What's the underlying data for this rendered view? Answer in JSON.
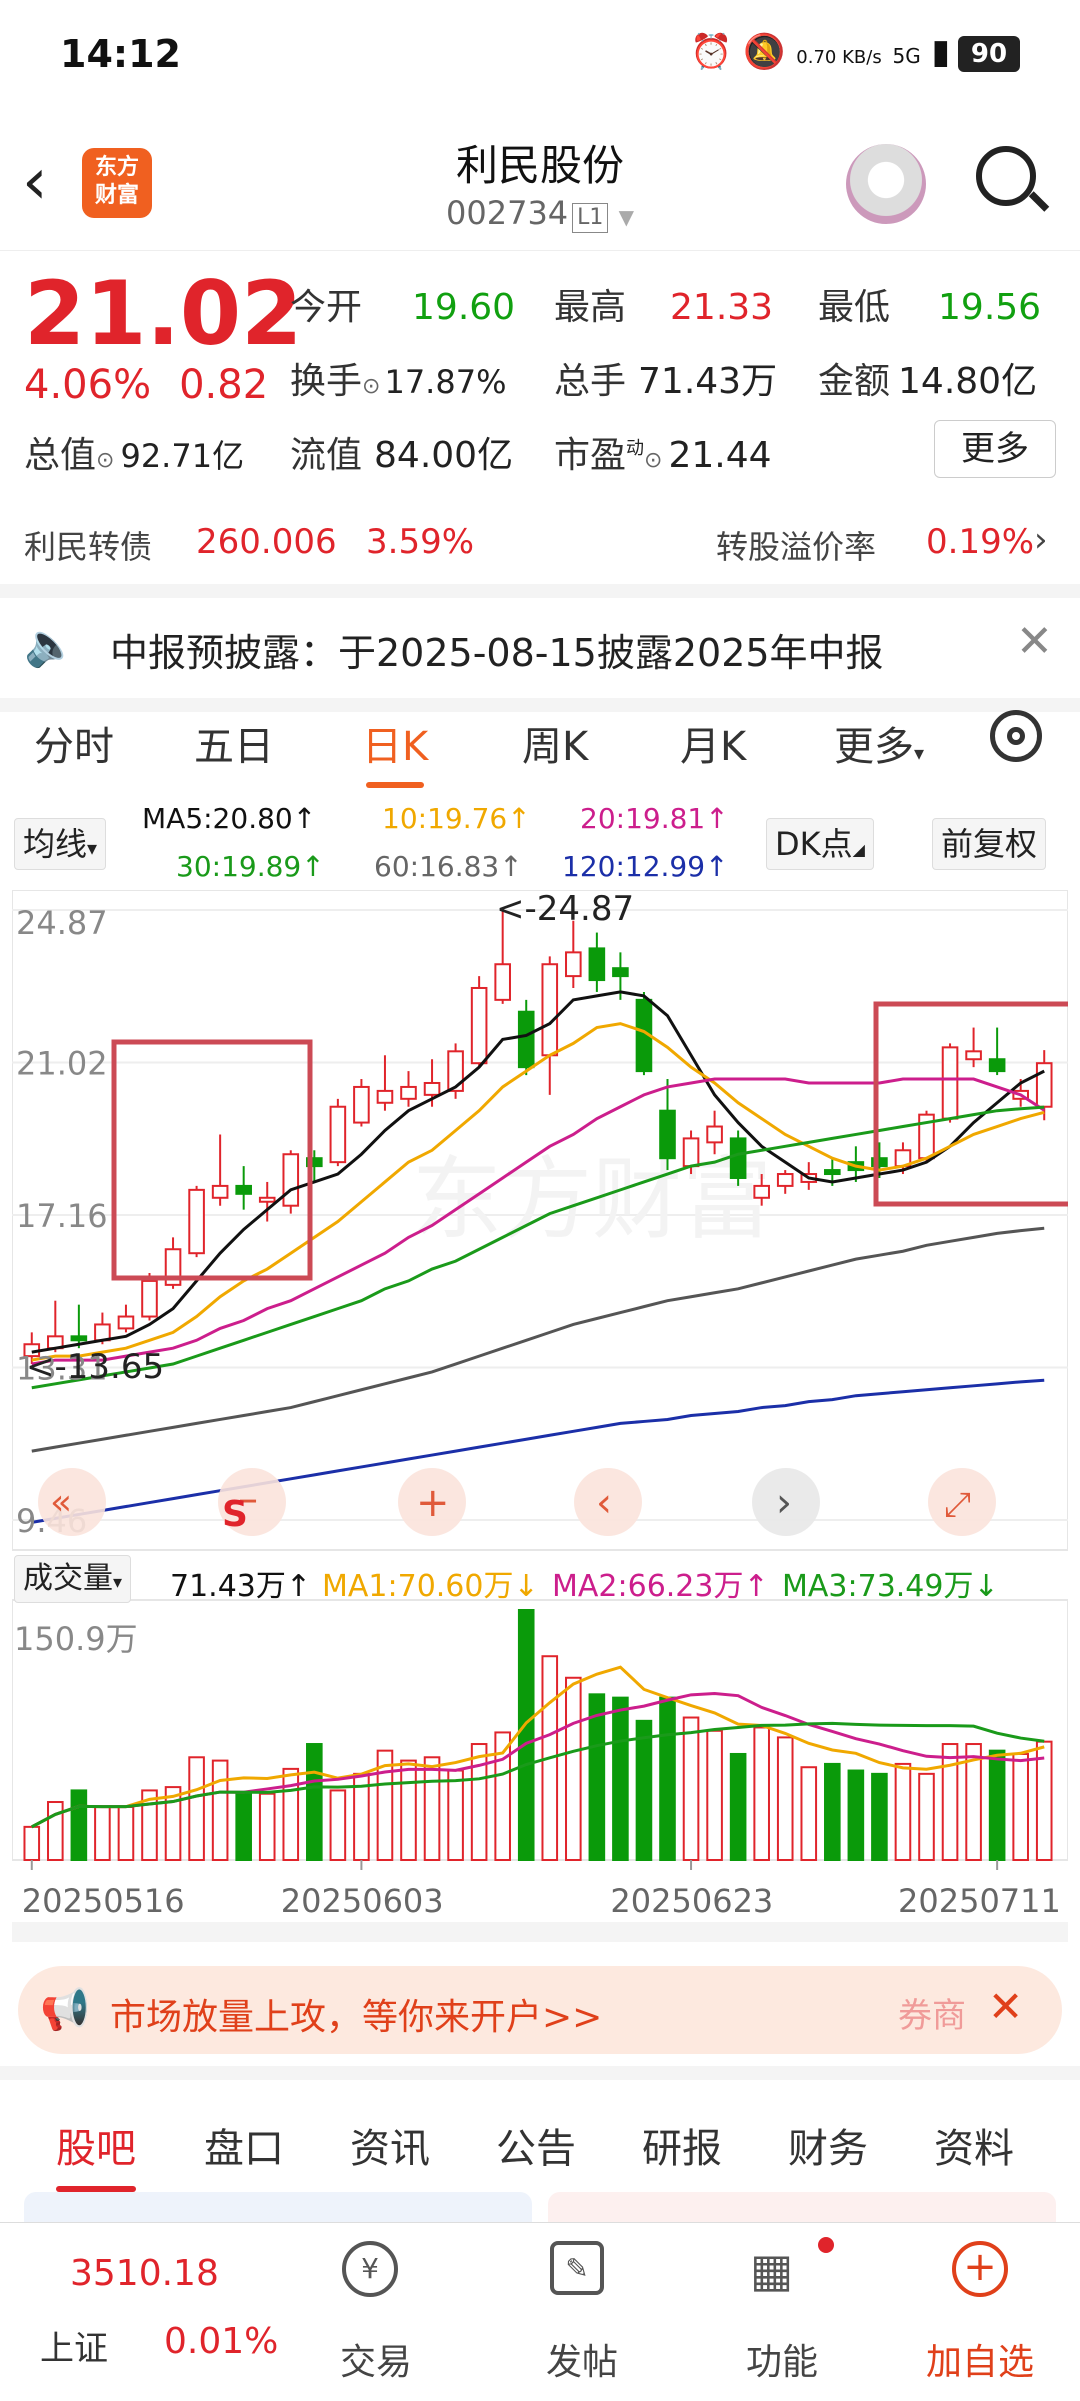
{
  "status": {
    "time": "14:12",
    "net_speed": "0.70 KB/s",
    "network": "5G",
    "battery": "90"
  },
  "header": {
    "title": "利民股份",
    "code": "002734",
    "board": "L1",
    "logo_line1": "东方",
    "logo_line2": "财富"
  },
  "quote": {
    "price": "21.02",
    "change_pct": "4.06%",
    "change": "0.82",
    "open_label": "今开",
    "open": "19.60",
    "high_label": "最高",
    "high": "21.33",
    "low_label": "最低",
    "low": "19.56",
    "turnover_label": "换手",
    "turnover": "17.87%",
    "volume_label": "总手",
    "volume": "71.43万",
    "amount_label": "金额",
    "amount": "14.80亿",
    "mktcap_label": "总值",
    "mktcap": "92.71亿",
    "float_label": "流值",
    "float": "84.00亿",
    "pe_label": "市盈",
    "pe_sup": "动",
    "pe": "21.44",
    "more": "更多"
  },
  "cbond": {
    "name": "利民转债",
    "price": "260.006",
    "pct": "3.59%",
    "premium_label": "转股溢价率",
    "premium": "0.19%"
  },
  "notice": {
    "text": "中报预披露：于2025-08-15披露2025年中报"
  },
  "ktabs": [
    "分时",
    "五日",
    "日K",
    "周K",
    "月K",
    "更多"
  ],
  "ma": {
    "selector": "均线",
    "ma5": "MA5:20.80",
    "ma10": "10:19.76",
    "ma20": "20:19.81",
    "ma30": "30:19.89",
    "ma60": "60:16.83",
    "ma120": "120:12.99",
    "dk": "DK点",
    "adjust": "前复权"
  },
  "chart_data": {
    "type": "candlestick",
    "y_labels": [
      "24.87",
      "21.02",
      "17.16",
      "13.31",
      "9.46"
    ],
    "high_annotation": "<-24.87",
    "low_annotation": "<-13.65",
    "x_labels": [
      "20250516",
      "20250603",
      "20250623",
      "20250711"
    ],
    "candles": [
      {
        "o": 13.6,
        "c": 13.9,
        "h": 14.2,
        "l": 13.4,
        "up": true
      },
      {
        "o": 13.8,
        "c": 14.1,
        "h": 15.0,
        "l": 13.7,
        "up": true
      },
      {
        "o": 14.1,
        "c": 14.0,
        "h": 14.9,
        "l": 13.8,
        "up": false
      },
      {
        "o": 14.0,
        "c": 14.4,
        "h": 14.7,
        "l": 13.9,
        "up": true
      },
      {
        "o": 14.3,
        "c": 14.6,
        "h": 14.9,
        "l": 14.2,
        "up": true
      },
      {
        "o": 14.6,
        "c": 15.5,
        "h": 15.7,
        "l": 14.5,
        "up": true
      },
      {
        "o": 15.4,
        "c": 16.3,
        "h": 16.6,
        "l": 15.3,
        "up": true
      },
      {
        "o": 16.2,
        "c": 17.8,
        "h": 17.9,
        "l": 16.1,
        "up": true
      },
      {
        "o": 17.6,
        "c": 17.9,
        "h": 19.2,
        "l": 17.4,
        "up": true
      },
      {
        "o": 17.9,
        "c": 17.7,
        "h": 18.4,
        "l": 17.3,
        "up": false
      },
      {
        "o": 17.5,
        "c": 17.6,
        "h": 18.0,
        "l": 17.0,
        "up": true
      },
      {
        "o": 17.4,
        "c": 18.7,
        "h": 18.8,
        "l": 17.2,
        "up": true
      },
      {
        "o": 18.6,
        "c": 18.4,
        "h": 18.8,
        "l": 18.0,
        "up": false
      },
      {
        "o": 18.5,
        "c": 19.9,
        "h": 20.1,
        "l": 18.4,
        "up": true
      },
      {
        "o": 19.5,
        "c": 20.4,
        "h": 20.6,
        "l": 19.4,
        "up": true
      },
      {
        "o": 20.0,
        "c": 20.3,
        "h": 21.2,
        "l": 19.8,
        "up": true
      },
      {
        "o": 20.1,
        "c": 20.4,
        "h": 20.8,
        "l": 19.9,
        "up": true
      },
      {
        "o": 20.2,
        "c": 20.5,
        "h": 21.1,
        "l": 19.9,
        "up": true
      },
      {
        "o": 20.3,
        "c": 21.3,
        "h": 21.5,
        "l": 20.1,
        "up": true
      },
      {
        "o": 21.0,
        "c": 22.9,
        "h": 23.2,
        "l": 20.9,
        "up": true
      },
      {
        "o": 22.6,
        "c": 23.5,
        "h": 24.87,
        "l": 22.5,
        "up": true
      },
      {
        "o": 22.3,
        "c": 20.9,
        "h": 22.6,
        "l": 20.7,
        "up": false
      },
      {
        "o": 21.2,
        "c": 23.5,
        "h": 23.7,
        "l": 20.2,
        "up": true
      },
      {
        "o": 23.2,
        "c": 23.8,
        "h": 24.6,
        "l": 22.9,
        "up": true
      },
      {
        "o": 23.9,
        "c": 23.1,
        "h": 24.3,
        "l": 22.8,
        "up": false
      },
      {
        "o": 23.4,
        "c": 23.2,
        "h": 23.8,
        "l": 22.6,
        "up": false
      },
      {
        "o": 22.6,
        "c": 20.8,
        "h": 22.8,
        "l": 20.7,
        "up": false
      },
      {
        "o": 19.8,
        "c": 18.6,
        "h": 20.6,
        "l": 18.3,
        "up": false
      },
      {
        "o": 18.4,
        "c": 19.1,
        "h": 19.3,
        "l": 18.2,
        "up": true
      },
      {
        "o": 19.0,
        "c": 19.4,
        "h": 19.8,
        "l": 18.7,
        "up": true
      },
      {
        "o": 19.1,
        "c": 18.1,
        "h": 19.3,
        "l": 17.9,
        "up": false
      },
      {
        "o": 17.6,
        "c": 17.9,
        "h": 18.2,
        "l": 17.4,
        "up": true
      },
      {
        "o": 17.9,
        "c": 18.2,
        "h": 18.3,
        "l": 17.7,
        "up": true
      },
      {
        "o": 18.0,
        "c": 18.2,
        "h": 18.5,
        "l": 17.8,
        "up": true
      },
      {
        "o": 18.2,
        "c": 18.3,
        "h": 18.6,
        "l": 17.9,
        "up": false
      },
      {
        "o": 18.3,
        "c": 18.5,
        "h": 18.9,
        "l": 18.0,
        "up": false
      },
      {
        "o": 18.4,
        "c": 18.6,
        "h": 19.0,
        "l": 18.1,
        "up": false
      },
      {
        "o": 18.4,
        "c": 18.8,
        "h": 19.0,
        "l": 18.2,
        "up": true
      },
      {
        "o": 18.6,
        "c": 19.7,
        "h": 19.8,
        "l": 18.5,
        "up": true
      },
      {
        "o": 19.6,
        "c": 21.4,
        "h": 21.5,
        "l": 19.5,
        "up": true
      },
      {
        "o": 21.1,
        "c": 21.3,
        "h": 21.9,
        "l": 20.9,
        "up": true
      },
      {
        "o": 21.1,
        "c": 20.8,
        "h": 21.9,
        "l": 20.7,
        "up": false
      },
      {
        "o": 20.1,
        "c": 20.3,
        "h": 20.6,
        "l": 19.9,
        "up": true
      },
      {
        "o": 19.9,
        "c": 21.0,
        "h": 21.33,
        "l": 19.56,
        "up": true
      }
    ],
    "ma_lines": [
      {
        "name": "MA5",
        "color": "#111111",
        "values": [
          13.7,
          13.8,
          13.9,
          14.0,
          14.1,
          14.4,
          14.8,
          15.5,
          16.2,
          16.8,
          17.3,
          17.8,
          18.0,
          18.2,
          18.7,
          19.3,
          19.8,
          20.1,
          20.4,
          20.9,
          21.6,
          21.7,
          22.0,
          22.6,
          22.7,
          22.8,
          22.7,
          22.2,
          21.2,
          20.2,
          19.5,
          18.9,
          18.5,
          18.1,
          18.0,
          18.1,
          18.2,
          18.3,
          18.5,
          18.9,
          19.5,
          20.0,
          20.5,
          20.8
        ]
      },
      {
        "name": "MA10",
        "color": "#f0a800",
        "values": [
          13.5,
          13.6,
          13.6,
          13.7,
          13.8,
          14.0,
          14.2,
          14.6,
          15.1,
          15.5,
          15.8,
          16.2,
          16.6,
          17.0,
          17.5,
          18.0,
          18.5,
          18.8,
          19.3,
          19.8,
          20.4,
          20.8,
          21.2,
          21.5,
          21.9,
          22.0,
          21.8,
          21.4,
          20.9,
          20.5,
          20.0,
          19.6,
          19.2,
          18.9,
          18.6,
          18.4,
          18.3,
          18.4,
          18.6,
          18.9,
          19.2,
          19.4,
          19.6,
          19.76
        ]
      },
      {
        "name": "MA20",
        "color": "#cc1e8c",
        "values": [
          13.4,
          13.5,
          13.5,
          13.5,
          13.6,
          13.7,
          13.8,
          14.0,
          14.3,
          14.5,
          14.8,
          15.0,
          15.3,
          15.6,
          15.9,
          16.2,
          16.6,
          16.9,
          17.3,
          17.7,
          18.1,
          18.5,
          18.9,
          19.2,
          19.6,
          19.9,
          20.2,
          20.4,
          20.5,
          20.6,
          20.6,
          20.6,
          20.6,
          20.5,
          20.5,
          20.5,
          20.5,
          20.6,
          20.6,
          20.6,
          20.6,
          20.4,
          20.2,
          19.81
        ]
      },
      {
        "name": "MA30",
        "color": "#1a9a1a",
        "values": [
          12.8,
          12.9,
          13.0,
          13.1,
          13.2,
          13.3,
          13.4,
          13.6,
          13.8,
          14.0,
          14.2,
          14.4,
          14.6,
          14.8,
          15.0,
          15.3,
          15.5,
          15.8,
          16.0,
          16.3,
          16.6,
          16.9,
          17.2,
          17.4,
          17.6,
          17.8,
          18.0,
          18.2,
          18.4,
          18.5,
          18.7,
          18.8,
          18.9,
          19.0,
          19.1,
          19.2,
          19.3,
          19.4,
          19.5,
          19.6,
          19.7,
          19.8,
          19.85,
          19.89
        ]
      },
      {
        "name": "MA60",
        "color": "#555555",
        "values": [
          11.2,
          11.3,
          11.4,
          11.5,
          11.6,
          11.7,
          11.8,
          11.9,
          12.0,
          12.1,
          12.2,
          12.3,
          12.45,
          12.6,
          12.75,
          12.9,
          13.05,
          13.2,
          13.4,
          13.6,
          13.8,
          14.0,
          14.2,
          14.4,
          14.55,
          14.7,
          14.85,
          15.0,
          15.1,
          15.2,
          15.3,
          15.45,
          15.6,
          15.75,
          15.9,
          16.05,
          16.15,
          16.25,
          16.4,
          16.5,
          16.6,
          16.7,
          16.77,
          16.83
        ]
      },
      {
        "name": "MA120",
        "color": "#1b2fa8",
        "values": [
          9.4,
          9.5,
          9.6,
          9.7,
          9.8,
          9.9,
          10.0,
          10.1,
          10.2,
          10.3,
          10.4,
          10.5,
          10.6,
          10.7,
          10.8,
          10.9,
          11.0,
          11.1,
          11.2,
          11.3,
          11.4,
          11.5,
          11.6,
          11.7,
          11.8,
          11.9,
          11.95,
          12.0,
          12.1,
          12.15,
          12.2,
          12.3,
          12.35,
          12.45,
          12.5,
          12.6,
          12.65,
          12.7,
          12.75,
          12.8,
          12.85,
          12.9,
          12.95,
          12.99
        ]
      }
    ],
    "ylim": [
      9.46,
      24.87
    ],
    "volume": {
      "label": "成交量",
      "current": "71.43万",
      "ma1": "MA1:70.60万",
      "ma2": "MA2:66.23万",
      "ma3": "MA3:73.49万",
      "max_label": "150.9万",
      "values": [
        20,
        35,
        42,
        32,
        32,
        42,
        44,
        62,
        60,
        40,
        40,
        55,
        70,
        42,
        52,
        66,
        60,
        62,
        54,
        70,
        77,
        150.9,
        123,
        110,
        100,
        98,
        84,
        98,
        86,
        78,
        64,
        80,
        74,
        56,
        58,
        54,
        52,
        58,
        52,
        70,
        70,
        66,
        64,
        71.43
      ]
    }
  },
  "banner": {
    "text": "市场放量上攻，等你来开户>>",
    "tag": "券商"
  },
  "btabs": [
    "股吧",
    "盘口",
    "资讯",
    "公告",
    "研报",
    "财务",
    "资料"
  ],
  "bottom": {
    "index_value": "3510.18",
    "index_name": "上证",
    "index_pct": "0.01%",
    "trade": "交易",
    "post": "发帖",
    "func": "功能",
    "add": "加自选"
  }
}
